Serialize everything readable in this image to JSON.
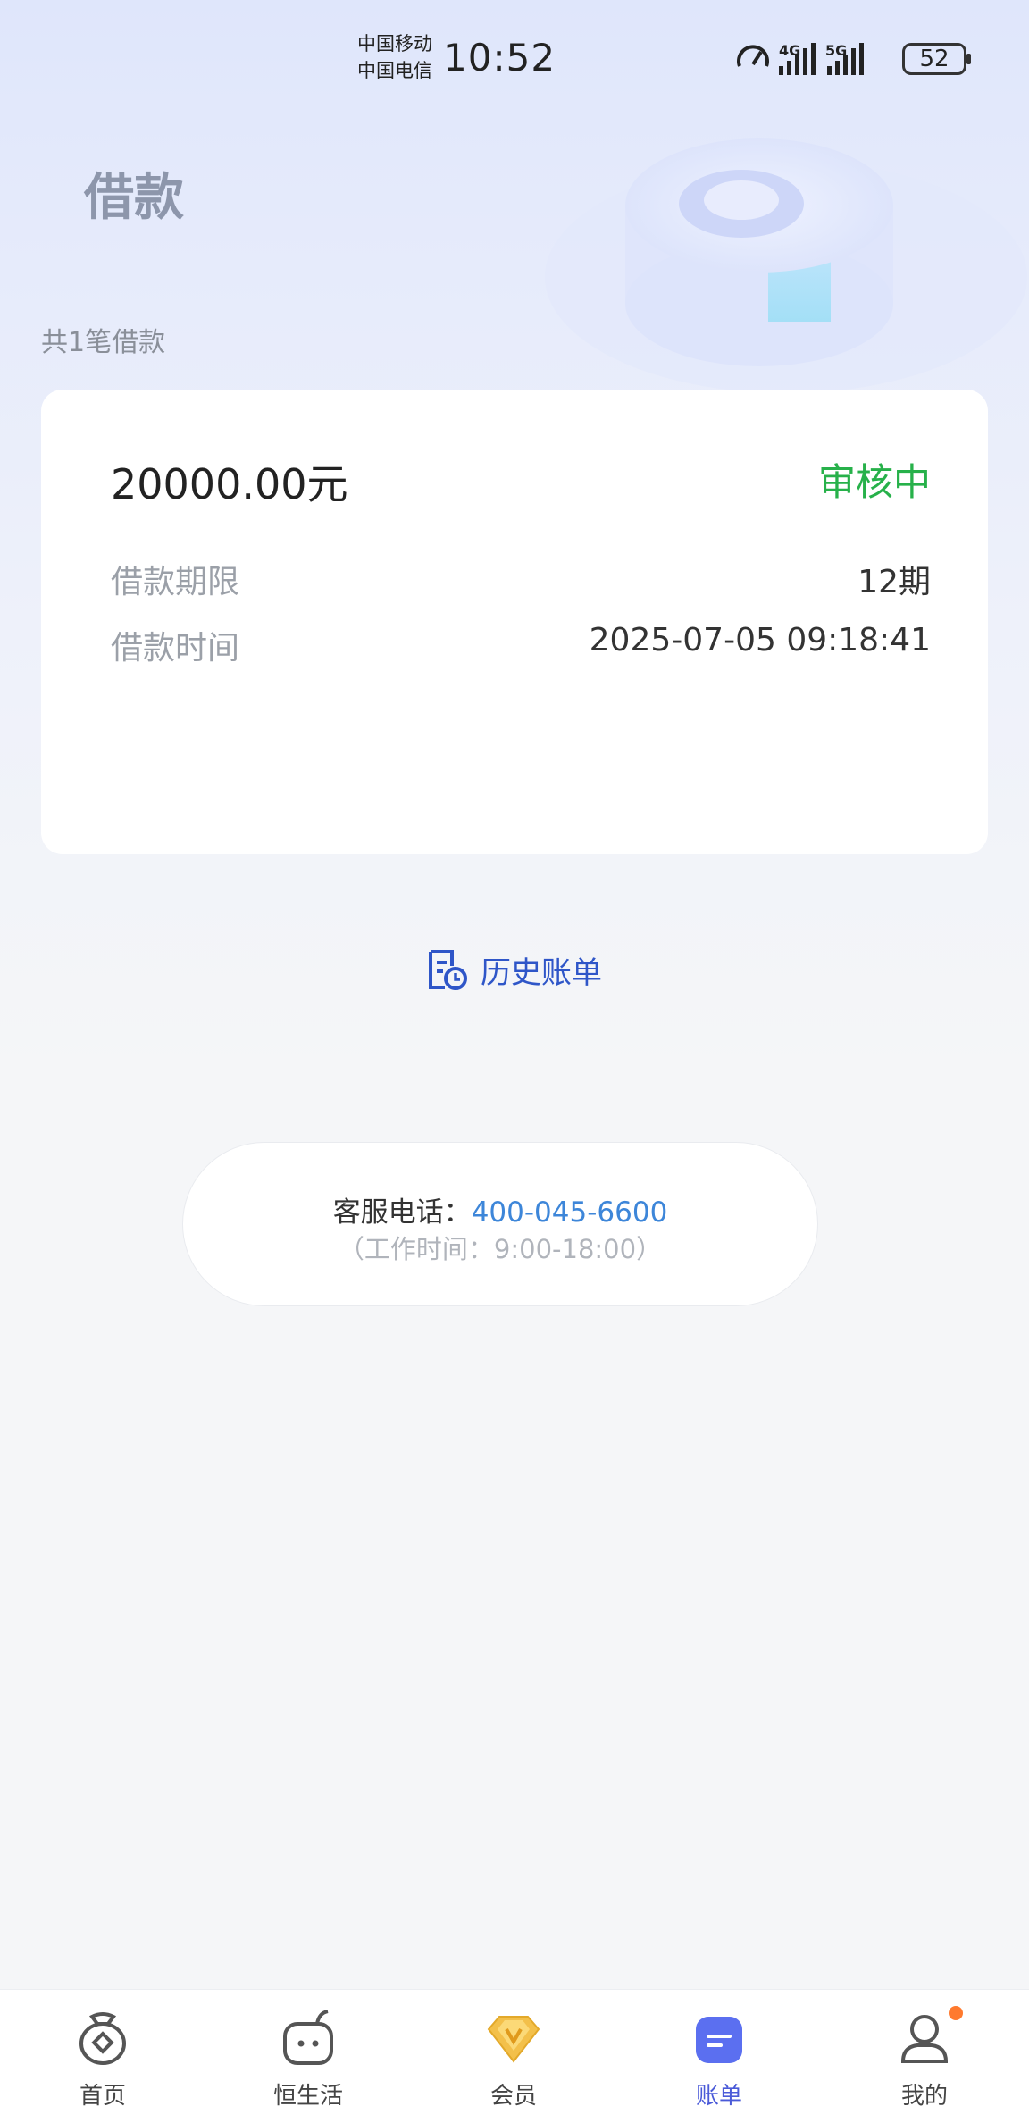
{
  "status_bar": {
    "carrier1": "中国移动",
    "carrier2": "中国电信",
    "time": "10:52",
    "battery": "52",
    "icons": [
      "speed-icon",
      "4g-signal-icon",
      "5g-signal-icon",
      "battery-icon"
    ]
  },
  "page": {
    "title": "借款",
    "loan_count": "共1笔借款"
  },
  "loan": {
    "amount": "20000.00元",
    "status": "审核中",
    "status_color": "#27b14a",
    "term_label": "借款期限",
    "term_value": "12期",
    "time_label": "借款时间",
    "time_value": "2025-07-05 09:18:41"
  },
  "history": {
    "label": "历史账单",
    "icon": "history-bill-icon",
    "color": "#2f56c8"
  },
  "service": {
    "label": "客服电话：",
    "phone": "400-045-6600",
    "hours": "（工作时间：9:00-18:00）"
  },
  "tabbar": {
    "items": [
      {
        "label": "首页",
        "icon": "home-bag-icon"
      },
      {
        "label": "恒生活",
        "icon": "life-icon"
      },
      {
        "label": "会员",
        "icon": "vip-diamond-icon"
      },
      {
        "label": "账单",
        "icon": "bill-icon",
        "active": true
      },
      {
        "label": "我的",
        "icon": "user-icon",
        "badge": true
      }
    ],
    "active_color": "#4a5ad8"
  }
}
